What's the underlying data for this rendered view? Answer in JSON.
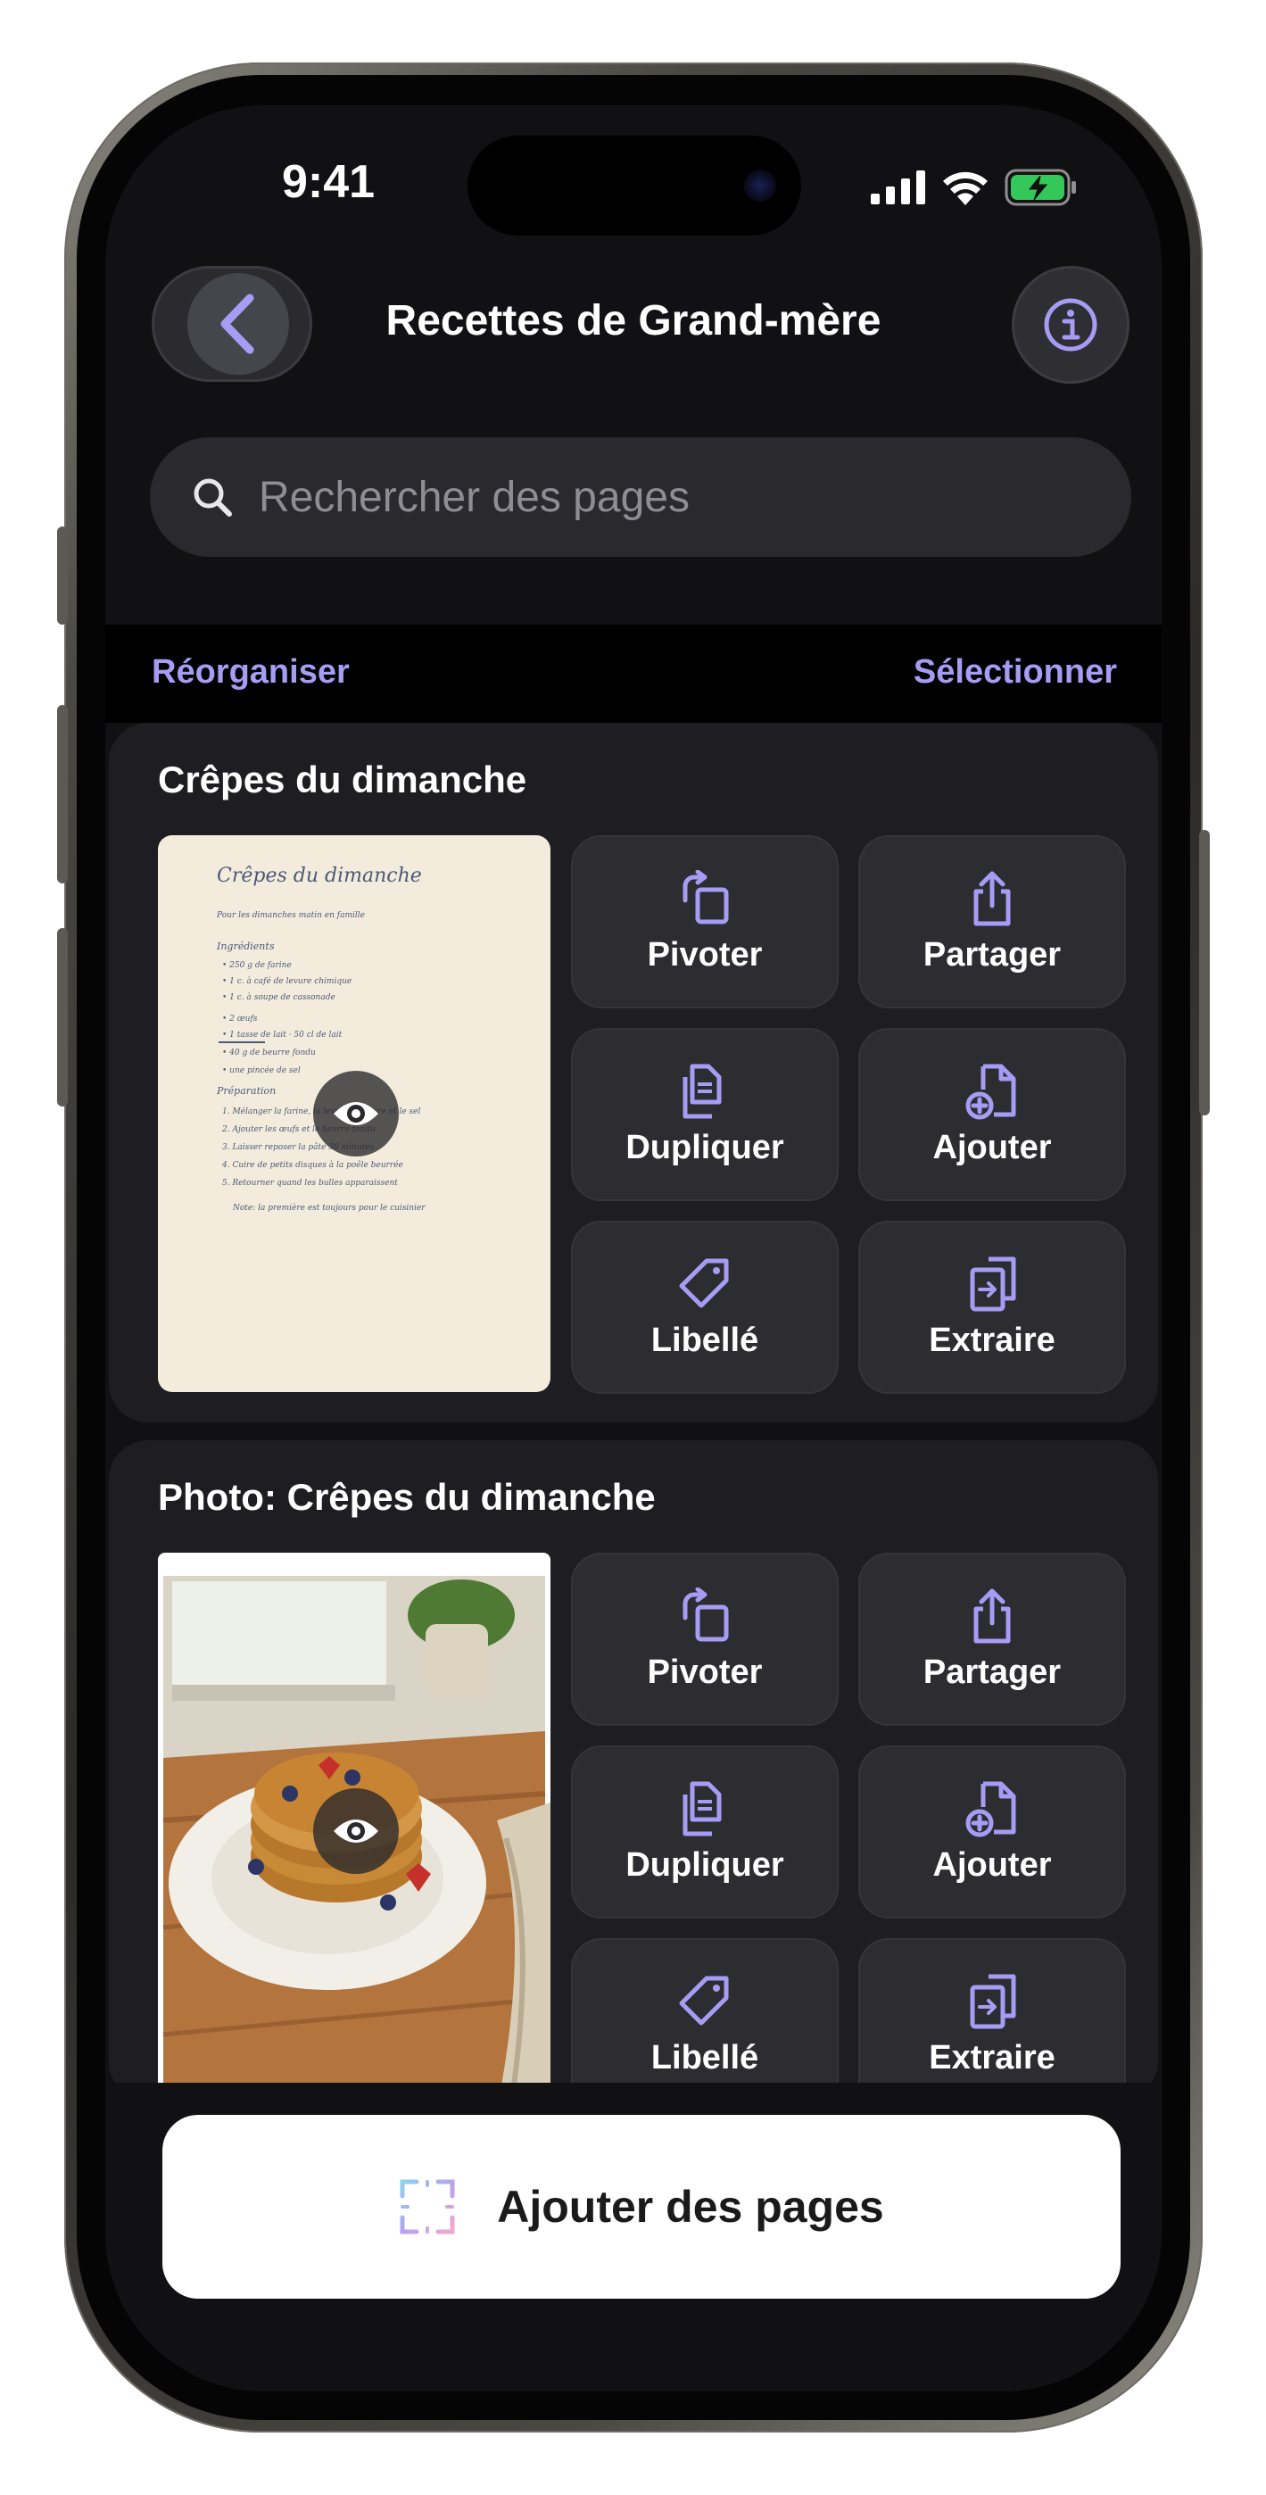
{
  "status_bar": {
    "time": "9:41"
  },
  "nav": {
    "title": "Recettes de Grand-mère"
  },
  "search": {
    "placeholder": "Rechercher des pages"
  },
  "toolbar": {
    "reorder_label": "Réorganiser",
    "select_label": "Sélectionner"
  },
  "pages": [
    {
      "title": "Crêpes du dimanche",
      "thumbnail": {
        "kind": "handwritten-recipe",
        "heading": "Crêpes du dimanche",
        "lines": [
          "Pour les dimanches matin en famille",
          "Ingrédients",
          "• 250 g de farine",
          "• 1 c. à café de levure chimique",
          "• 1 c. à soupe de cassonade",
          "• 2 œufs",
          "• 1 tasse de lait · 50 cl de lait",
          "• 40 g de beurre fondu",
          "• une pincée de sel",
          "Préparation",
          "1. Mélanger la farine, la levure, le sucre et le sel",
          "2. Ajouter les œufs et le beurre fondu",
          "3. Laisser reposer la pâte 30 minutes",
          "4. Cuire de petits disques à la poêle beurrée",
          "5. Retourner quand les bulles apparaissent",
          "Note: la première est toujours pour le cuisinier"
        ]
      },
      "actions": [
        {
          "label": "Pivoter",
          "icon": "rotate-icon"
        },
        {
          "label": "Partager",
          "icon": "share-icon"
        },
        {
          "label": "Dupliquer",
          "icon": "duplicate-icon"
        },
        {
          "label": "Ajouter",
          "icon": "add-document-icon"
        },
        {
          "label": "Libellé",
          "icon": "tag-icon"
        },
        {
          "label": "Extraire",
          "icon": "extract-icon"
        }
      ]
    },
    {
      "title": "Photo: Crêpes du dimanche",
      "thumbnail": {
        "kind": "photo-pancakes"
      },
      "actions": [
        {
          "label": "Pivoter",
          "icon": "rotate-icon"
        },
        {
          "label": "Partager",
          "icon": "share-icon"
        },
        {
          "label": "Dupliquer",
          "icon": "duplicate-icon"
        },
        {
          "label": "Ajouter",
          "icon": "add-document-icon"
        },
        {
          "label": "Libellé",
          "icon": "tag-icon"
        },
        {
          "label": "Extraire",
          "icon": "extract-icon"
        }
      ]
    }
  ],
  "bottom": {
    "add_pages_label": "Ajouter des pages"
  },
  "colors": {
    "accent": "#a79cf4",
    "screen_bg": "#111114",
    "card_bg": "#1e1e22",
    "button_bg": "#2c2c31"
  }
}
